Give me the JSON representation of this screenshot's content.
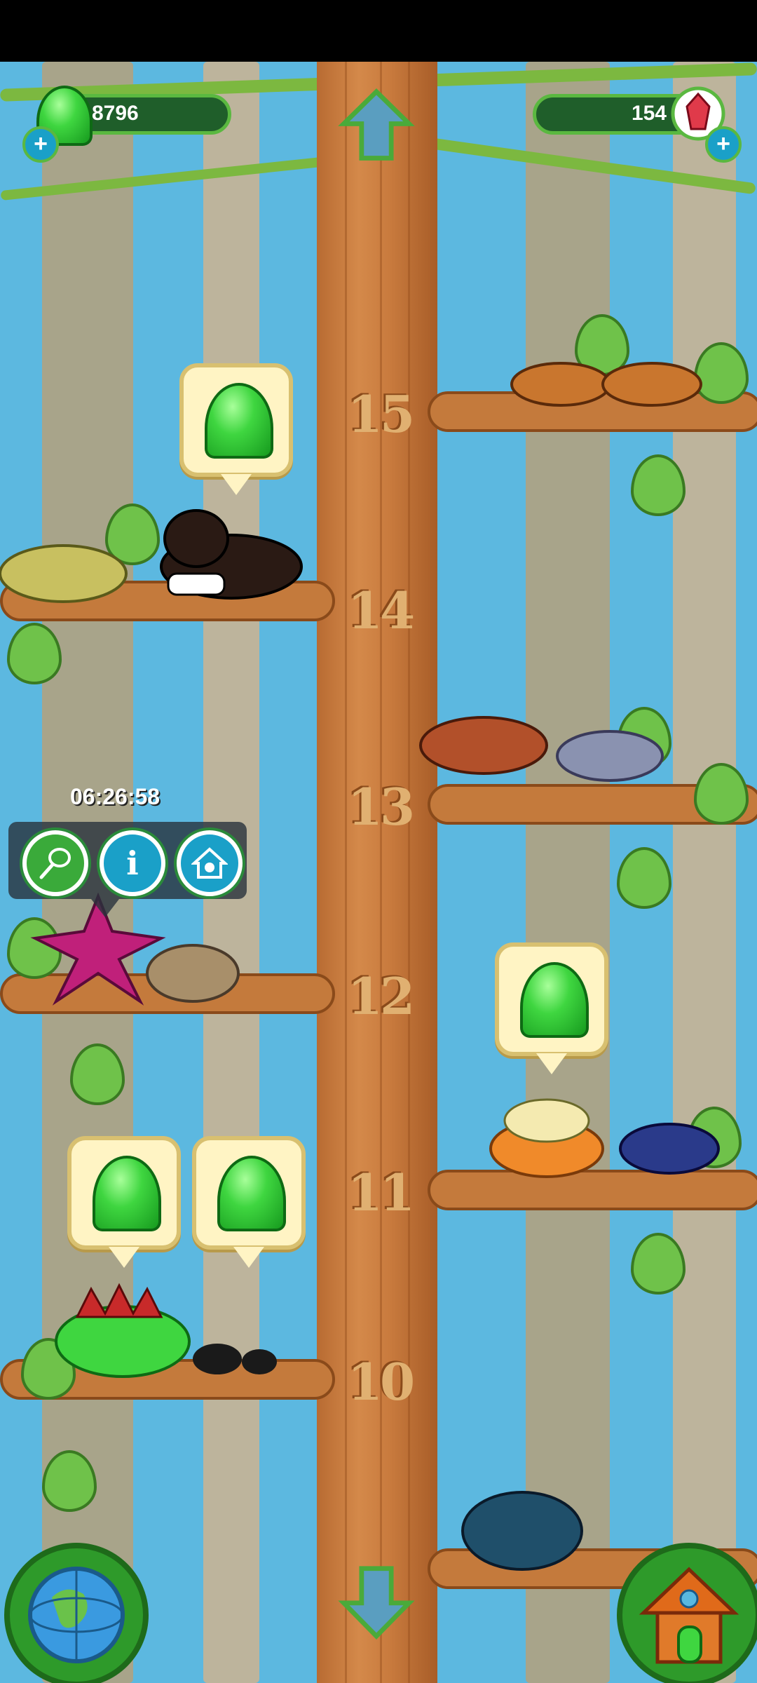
{
  "hud": {
    "jelly_count": "8796",
    "gem_count": "154",
    "jelly_icon": "green-jelly-icon",
    "gem_icon": "red-crystal-icon",
    "add_icon": "plus-icon"
  },
  "tree": {
    "levels": [
      "15",
      "14",
      "13",
      "12",
      "11",
      "10"
    ]
  },
  "popup": {
    "timer": "06:26:58",
    "buttons": [
      {
        "icon": "net-icon"
      },
      {
        "icon": "info-icon",
        "glyph": "i"
      },
      {
        "icon": "home-icon"
      }
    ]
  },
  "navigation": {
    "up_icon": "arrow-up-icon",
    "down_icon": "arrow-down-icon",
    "globe_icon": "globe-icon",
    "house_icon": "house-icon"
  },
  "colors": {
    "sky": "#5cb8e0",
    "trunk": "#c97b3e",
    "jelly": "#3fd640",
    "hud_bar": "#1f5e2a"
  }
}
